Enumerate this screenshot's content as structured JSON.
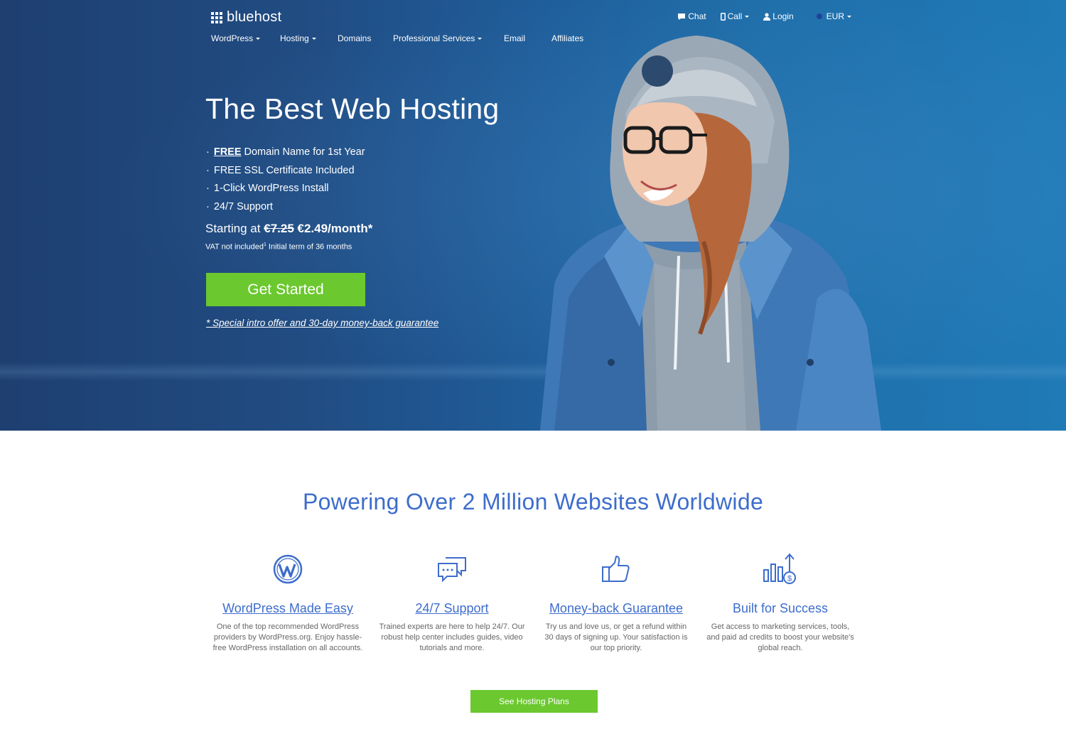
{
  "brand": {
    "name": "bluehost"
  },
  "utility_nav": {
    "chat": "Chat",
    "call": "Call",
    "login": "Login",
    "currency": "EUR"
  },
  "main_nav": [
    {
      "label": "WordPress",
      "dropdown": true
    },
    {
      "label": "Hosting",
      "dropdown": true
    },
    {
      "label": "Domains",
      "dropdown": false
    },
    {
      "label": "Professional Services",
      "dropdown": true
    },
    {
      "label": "Email",
      "dropdown": false
    },
    {
      "label": "Affiliates",
      "dropdown": false
    }
  ],
  "hero": {
    "title": "The Best Web Hosting",
    "bullet_dot": "·",
    "bullets": [
      {
        "em": "FREE",
        "text": "Domain Name for 1st Year"
      },
      {
        "em": "",
        "text": "FREE SSL Certificate Included"
      },
      {
        "em": "",
        "text": "1-Click WordPress Install"
      },
      {
        "em": "",
        "text": "24/7 Support"
      }
    ],
    "price_prefix": "Starting at",
    "price_old": "€7.25",
    "price_new": "€2.49/month*",
    "vat_text": "VAT not included",
    "vat_sup": "1",
    "term_text": "Initial term of 36 months",
    "cta": "Get Started",
    "offer_link": "* Special intro offer and 30-day money-back guarantee"
  },
  "features_section": {
    "title": "Powering Over 2 Million Websites Worldwide",
    "features": [
      {
        "icon": "wordpress-icon",
        "title": "WordPress Made Easy",
        "link": true,
        "desc": "One of the top recommended WordPress providers by WordPress.org. Enjoy hassle-free WordPress installation on all accounts."
      },
      {
        "icon": "chat-bubbles-icon",
        "title": "24/7 Support",
        "link": true,
        "desc": "Trained experts are here to help 24/7. Our robust help center includes guides, video tutorials and more."
      },
      {
        "icon": "thumbs-up-icon",
        "title": "Money-back Guarantee",
        "link": true,
        "desc": "Try us and love us, or get a refund within 30 days of signing up. Your satisfaction is our top priority."
      },
      {
        "icon": "growth-chart-icon",
        "title": "Built for Success",
        "link": false,
        "desc": "Get access to marketing services, tools, and paid ad credits to boost your website's global reach."
      }
    ],
    "cta": "See Hosting Plans"
  },
  "colors": {
    "brand_blue": "#3d6dcc",
    "cta_green": "#6bc82f",
    "hero_dark": "#1e3f70",
    "hero_light": "#1f7ab6"
  }
}
